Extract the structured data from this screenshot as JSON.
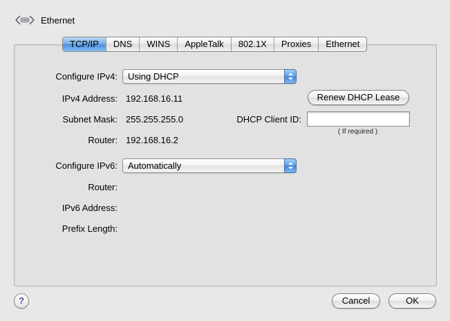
{
  "window": {
    "title": "Ethernet"
  },
  "tabs": [
    "TCP/IP",
    "DNS",
    "WINS",
    "AppleTalk",
    "802.1X",
    "Proxies",
    "Ethernet"
  ],
  "ipv4": {
    "configure_label": "Configure IPv4:",
    "configure_value": "Using DHCP",
    "address_label": "IPv4 Address:",
    "address_value": "192.168.16.11",
    "subnet_label": "Subnet Mask:",
    "subnet_value": "255.255.255.0",
    "router_label": "Router:",
    "router_value": "192.168.16.2",
    "renew_button": "Renew DHCP Lease",
    "client_id_label": "DHCP Client ID:",
    "client_id_value": "",
    "client_id_hint": "( If required )"
  },
  "ipv6": {
    "configure_label": "Configure IPv6:",
    "configure_value": "Automatically",
    "router_label": "Router:",
    "address_label": "IPv6 Address:",
    "prefix_label": "Prefix Length:"
  },
  "footer": {
    "help_glyph": "?",
    "cancel_button": "Cancel",
    "ok_button": "OK"
  },
  "colors": {
    "active_tab": "#4c8fe0",
    "popup_arrow": "#3b84dc"
  }
}
